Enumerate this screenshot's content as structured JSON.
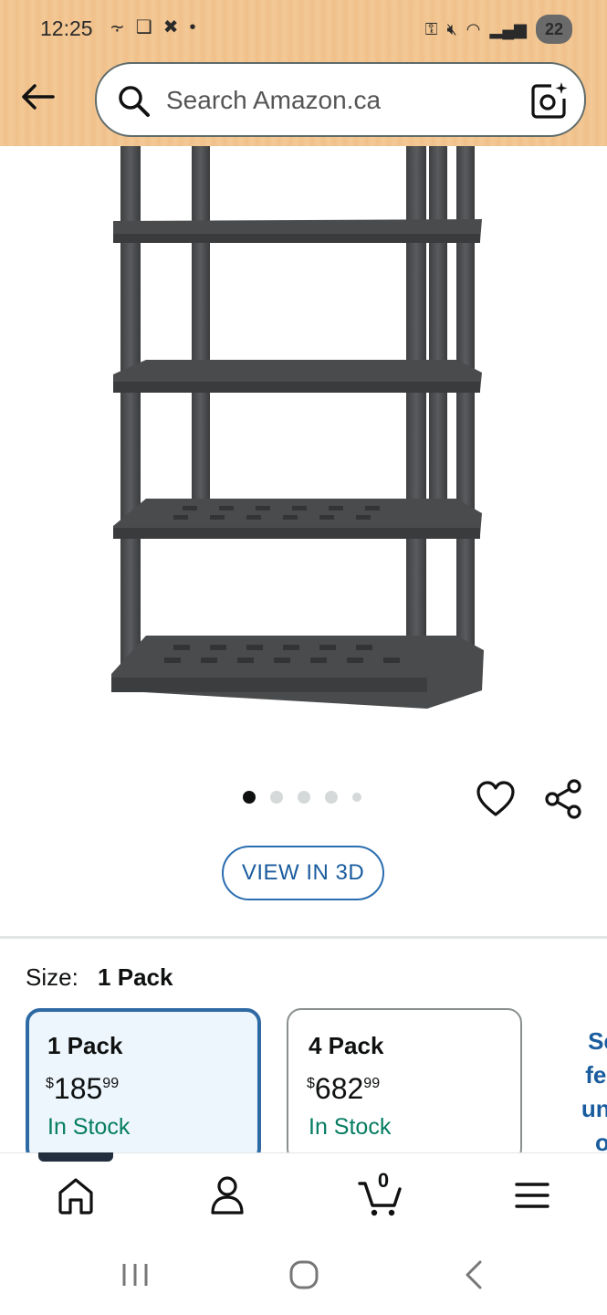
{
  "status_bar": {
    "time": "12:25",
    "battery": "22"
  },
  "search": {
    "placeholder": "Search Amazon.ca"
  },
  "product": {
    "image_alt": "Plastic shelving unit",
    "carousel_dots": 5,
    "carousel_active": 0,
    "view_3d_label": "VIEW IN 3D"
  },
  "size": {
    "label": "Size:",
    "selected": "1 Pack",
    "options": [
      {
        "title": "1 Pack",
        "price_currency": "$",
        "price_whole": "185",
        "price_fraction": "99",
        "stock": "In Stock",
        "selected": true
      },
      {
        "title": "4 Pack",
        "price_currency": "$",
        "price_whole": "682",
        "price_fraction": "99",
        "stock": "In Stock",
        "selected": false
      }
    ],
    "see_more_lines": [
      "Se",
      "fea",
      "una",
      "o"
    ]
  },
  "bottom_nav": {
    "cart_count": "0",
    "items": [
      "home-icon",
      "account-icon",
      "cart-icon",
      "menu-icon"
    ]
  },
  "colors": {
    "header_bg": "#f3c996",
    "accent_blue": "#2e6aa3",
    "in_stock_green": "#067d62",
    "selected_card_bg": "#edf6fd"
  }
}
